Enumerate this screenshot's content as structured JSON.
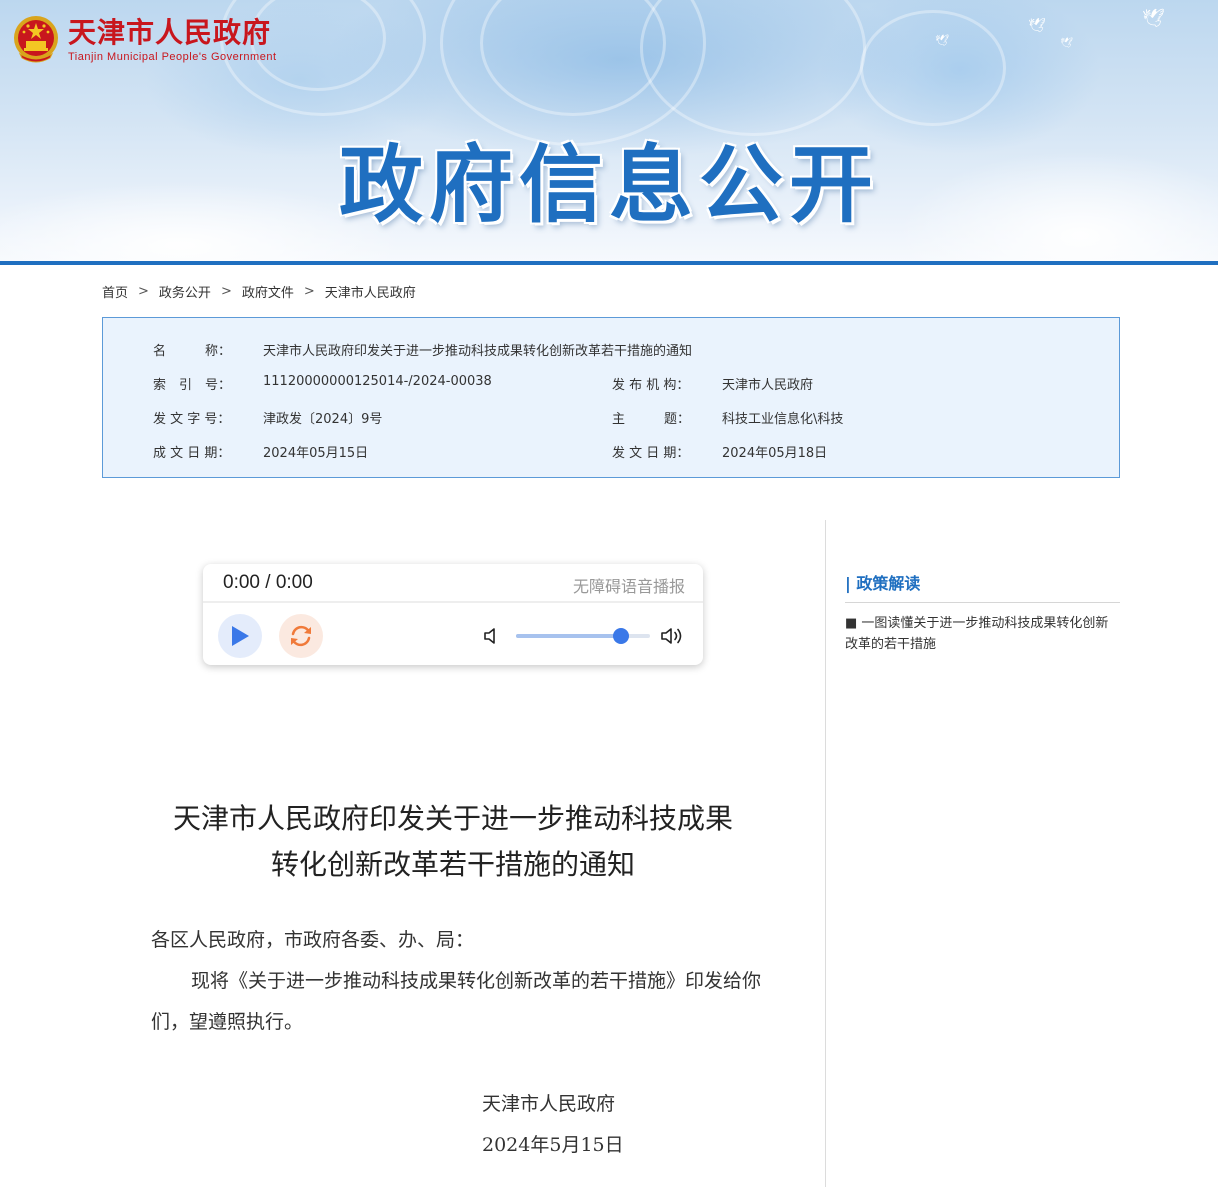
{
  "header": {
    "logo_cn": "天津市人民政府",
    "logo_en": "Tianjin Municipal People's Government",
    "banner_title": "政府信息公开"
  },
  "breadcrumb": [
    "首页",
    "政务公开",
    "政府文件",
    "天津市人民政府"
  ],
  "info": {
    "name_label": "名　　　称：",
    "name_value": "天津市人民政府印发关于进一步推动科技成果转化创新改革若干措施的通知",
    "index_label": "索　引　号：",
    "index_value": "11120000000125014-/2024-00038",
    "publisher_label": "发 布 机 构：",
    "publisher_value": "天津市人民政府",
    "docno_label": "发 文 字 号：",
    "docno_value": "津政发〔2024〕9号",
    "topic_label": "主　　　题：",
    "topic_value": "科技工业信息化\\科技",
    "written_label": "成 文 日 期：",
    "written_value": "2024年05月15日",
    "issued_label": "发 文 日 期：",
    "issued_value": "2024年05月18日"
  },
  "player": {
    "time": "0:00 / 0:00",
    "title": "无障碍语音播报",
    "volume": 0.78,
    "colors": {
      "play": "#3a78e8",
      "loop": "#f07a3a"
    }
  },
  "document": {
    "title_line1": "天津市人民政府印发关于进一步推动科技成果",
    "title_line2": "转化创新改革若干措施的通知",
    "salutation": "各区人民政府，市政府各委、办、局：",
    "body": "现将《关于进一步推动科技成果转化创新改革的若干措施》印发给你们，望遵照执行。",
    "signer": "天津市人民政府",
    "date": "2024年5月15日"
  },
  "sidebar": {
    "heading": "| 政策解读",
    "links": [
      "■ 一图读懂关于进一步推动科技成果转化创新改革的若干措施"
    ]
  },
  "colors": {
    "brand_red": "#c8161d",
    "brand_blue": "#1f6fc0"
  }
}
